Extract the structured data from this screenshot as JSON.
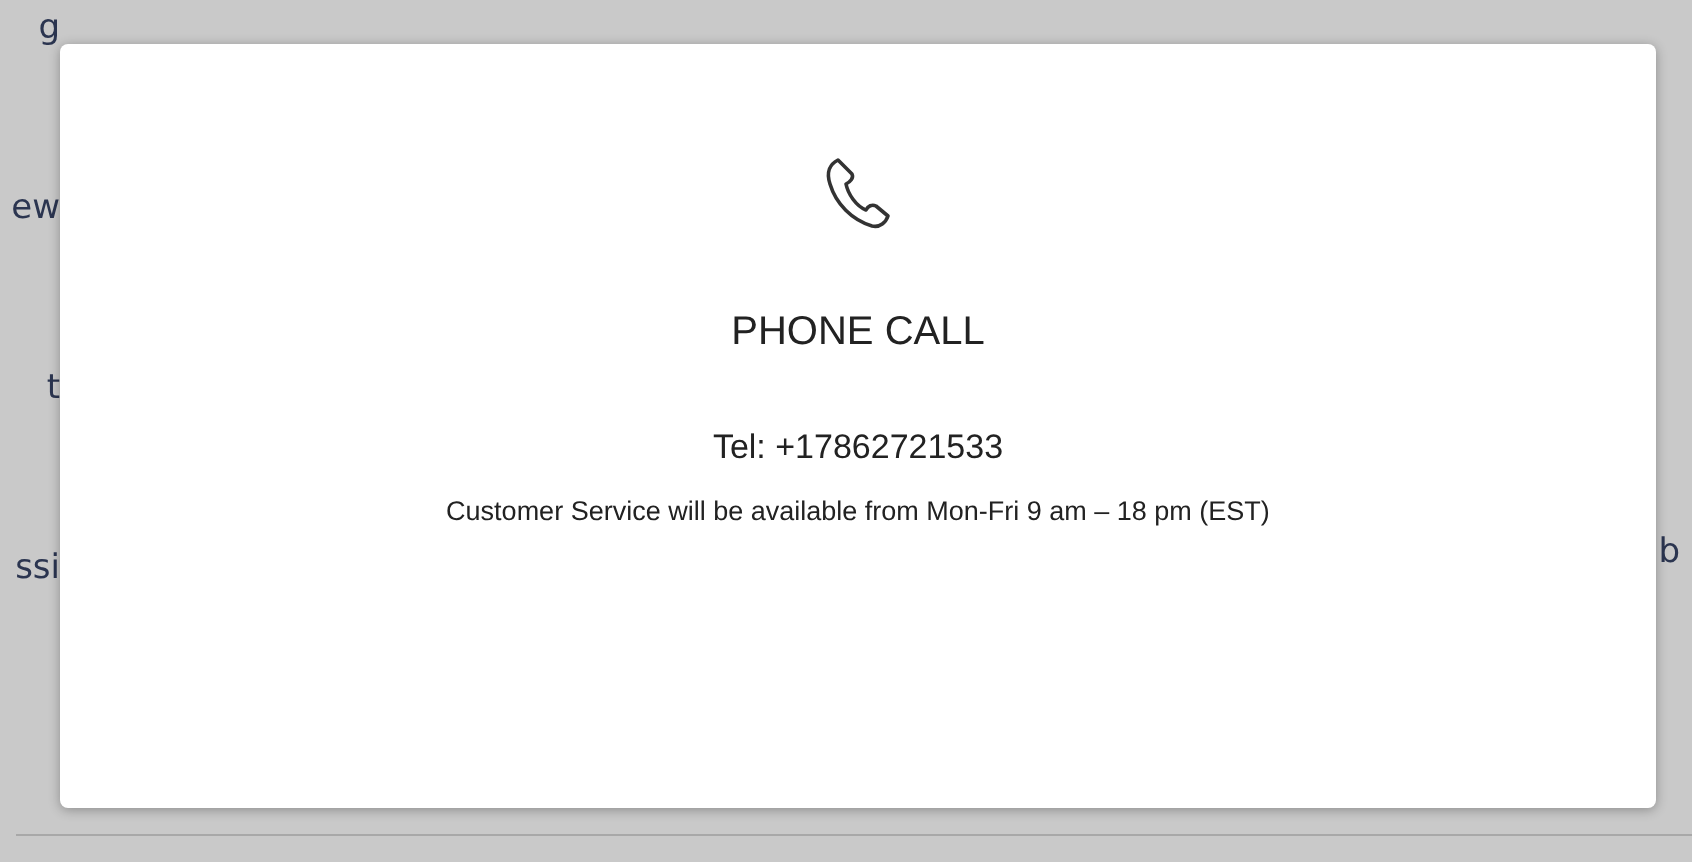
{
  "background": {
    "left_fragments": [
      "g",
      "ew",
      "t",
      "ssi"
    ],
    "right_fragments": [
      "b"
    ]
  },
  "dialog": {
    "title": "PHONE CALL",
    "phone": "Tel: +17862721533",
    "hours": "Customer Service will be available from Mon-Fri 9 am – 18 pm (EST)"
  }
}
